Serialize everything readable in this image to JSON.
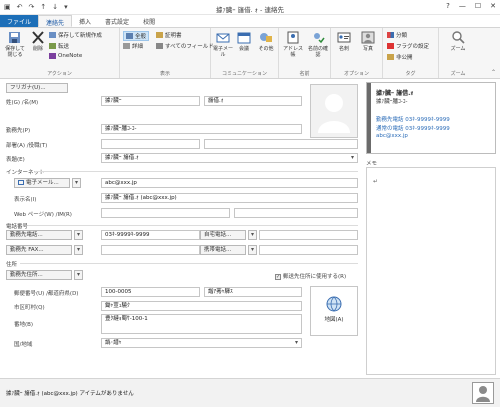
{
  "window": {
    "title": "據ｧ臓ｰ 旛借. ｫ - 連絡先",
    "controls": [
      "?",
      "—",
      "☐",
      "✕"
    ]
  },
  "qat": [
    "save-icon",
    "undo-icon",
    "redo-icon",
    "up-icon",
    "down-icon",
    "more-icon"
  ],
  "tabs": [
    "ファイル",
    "連絡先",
    "挿入",
    "書式設定",
    "校閲"
  ],
  "ribbon": {
    "action": {
      "label": "アクション",
      "save_close": "保存して閉じる",
      "delete": "削除",
      "save_new": "保存して新規作成",
      "forward": "転送",
      "onenote": "OneNote"
    },
    "view": {
      "label": "表示",
      "general": "全般",
      "details": "詳細",
      "cert": "証明書",
      "allfields": "すべてのフィールド"
    },
    "comm": {
      "label": "コミュニケーション",
      "email": "電子メール",
      "meeting": "会議",
      "more": "その他"
    },
    "names": {
      "label": "名前",
      "addressbook": "アドレス帳",
      "checknames": "名前の確認"
    },
    "options": {
      "label": "オプション",
      "card": "名刺",
      "photo": "写真"
    },
    "tags": {
      "label": "タグ",
      "categorize": "分類",
      "followup": "フラグの設定",
      "private": "非公開"
    },
    "zoom": {
      "label": "ズーム",
      "zoom": "ズーム"
    }
  },
  "form": {
    "furigana_btn": "フリガナ(U)...",
    "name_label": "姓(G) /名(M)",
    "last": "據ｧ臓ｰ",
    "first": "旛借.ｫ",
    "company_label": "勤務先(P)",
    "company": "據ｧ臓ｰ膰ｺ-ｺ-",
    "dept_label": "部署(A) /役職(T)",
    "dept": "",
    "title": "",
    "fileas_label": "表題(E)",
    "fileas": "據ｧ臓ｰ 旛借.ｫ",
    "internet_section": "インターネット",
    "email_btn": "電子メール...",
    "email": "abc@xxx.jp",
    "display_label": "表示名(I)",
    "display": "據ｧ臓ｰ 旛借.ｫ (abc@xxx.jp)",
    "web_label": "Web ページ(W) /IM(R)",
    "web": "",
    "im": "",
    "phone_section": "電話番号",
    "phone_work_btn": "勤務先電話...",
    "phone_work": "03ｷ-9999ｷ-9999",
    "phone_home_btn": "自宅電話...",
    "phone_home": "",
    "fax_btn": "勤務先 FAX...",
    "fax": "",
    "mobile_btn": "携帯電話...",
    "mobile": "",
    "address_section": "住所",
    "addr_btn": "勤務先住所...",
    "mailing_check": "郵送先住所に使用する(R)",
    "zip_label": "郵便番号(U) /都道府県(D)",
    "zip": "100-0005",
    "pref": "諧ｱ莠ｬ驛ｽ",
    "city_label": "市区町村(Q)",
    "city": "鋤ｬ荳ｭ驍ｸ",
    "street_label": "番地(B)",
    "street": "豊ｸ縺ｮ蜀ｻ-100-1",
    "country_label": "国/地域",
    "country": "譌･譛ｬ",
    "map_btn": "地図(A)"
  },
  "card": {
    "name": "據ｧ臓ｰ 旛借.ｫ",
    "company": "據ｧ臓ｰ膰ｺ-ｺ-",
    "tel_label": "勤務先電話",
    "tel": "03ｷ-9999ｷ-9999",
    "tel2_label": "通常の電話",
    "tel2": "03ｷ-9999ｷ-9999",
    "email": "abc@xxx.jp"
  },
  "memo_label": "メモ",
  "status": {
    "text": "據ｧ臓ｰ 旛借.ｫ (abc@xxx.jp) アイテムがありません"
  }
}
